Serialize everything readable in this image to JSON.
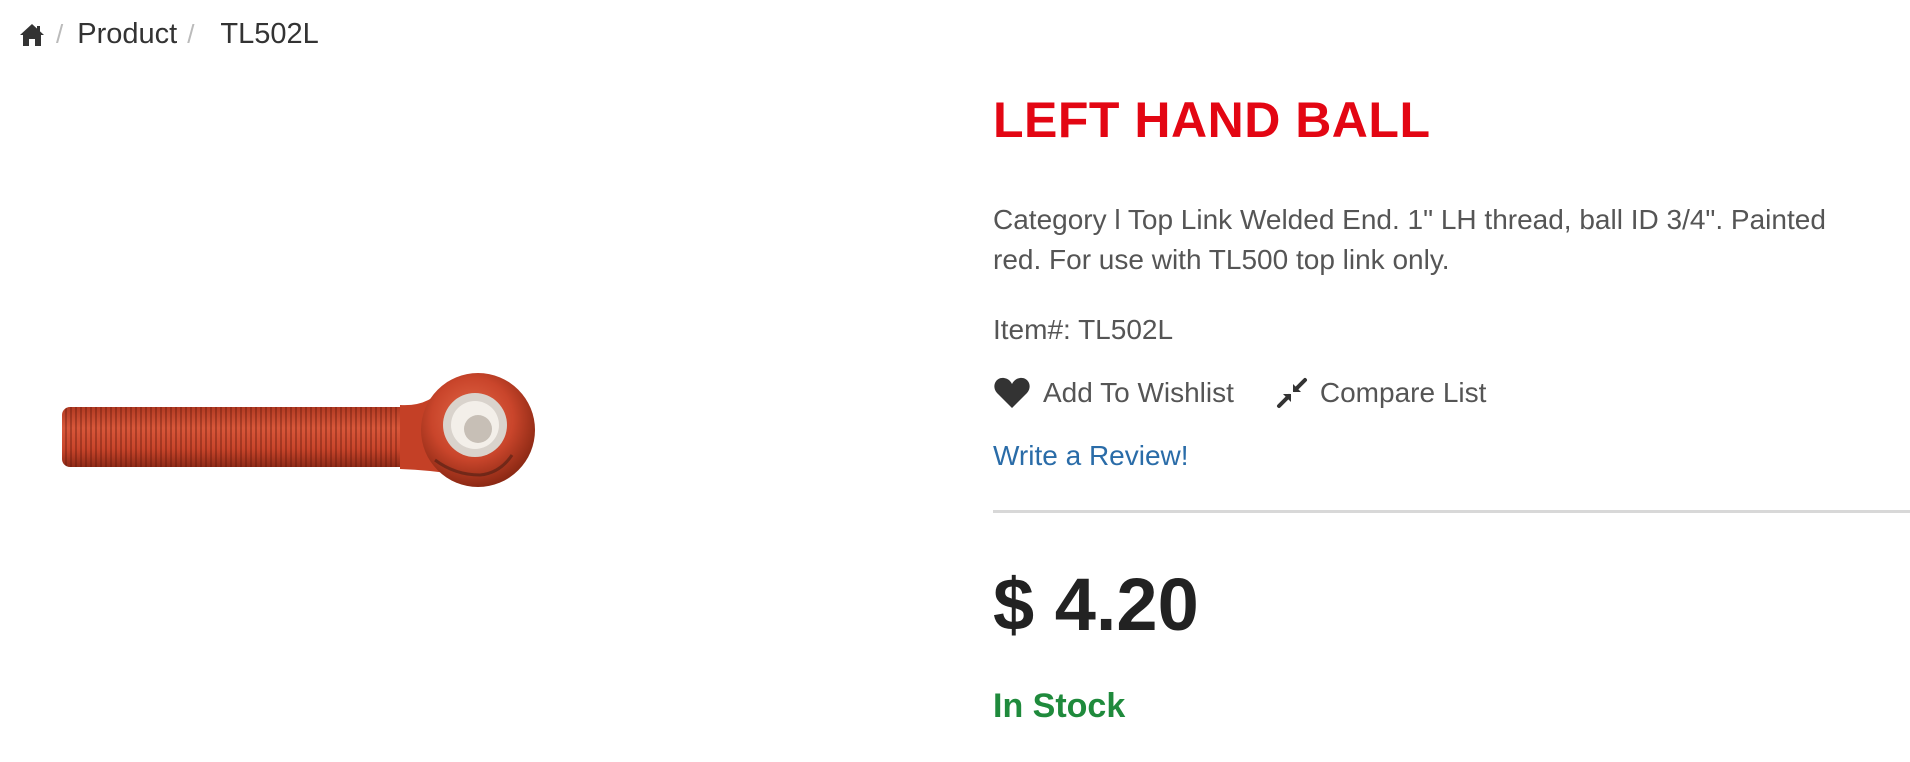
{
  "breadcrumb": {
    "home_icon": "home-icon",
    "items": [
      {
        "label": "Product"
      },
      {
        "label": "TL502L"
      }
    ]
  },
  "product": {
    "image_alt": "Left hand ball top link end (red, threaded)",
    "title": "LEFT HAND BALL",
    "description": "Category l Top Link Welded End. 1\" LH thread, ball ID 3/4\". Painted red. For use with TL500 top link only.",
    "item_number": "Item#: TL502L",
    "wishlist_label": "Add To Wishlist",
    "compare_label": "Compare List",
    "review_label": "Write a Review!",
    "price": "$ 4.20",
    "stock_status": "In Stock"
  },
  "colors": {
    "title": "#e30613",
    "link": "#2a6ca8",
    "in_stock": "#1f8a3c",
    "product_paint": "#c9452b"
  }
}
